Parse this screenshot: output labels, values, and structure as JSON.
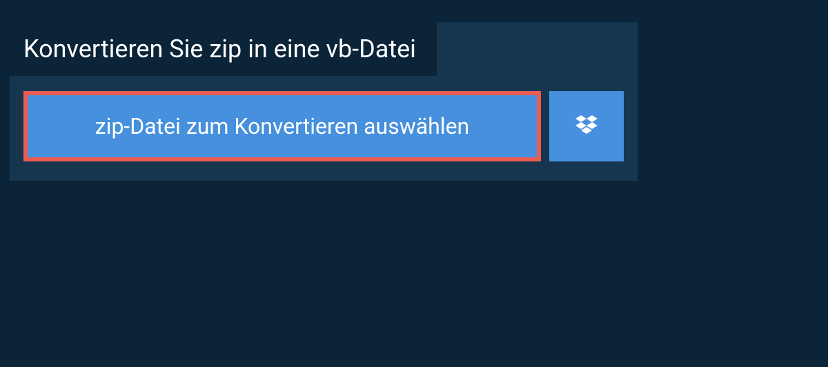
{
  "title": "Konvertieren Sie zip in eine vb-Datei",
  "selectButton": {
    "label": "zip-Datei zum Konvertieren auswählen"
  },
  "colors": {
    "background": "#0c2438",
    "panel": "#16364f",
    "buttonBg": "#4690dd",
    "highlight": "#eb5d53"
  }
}
